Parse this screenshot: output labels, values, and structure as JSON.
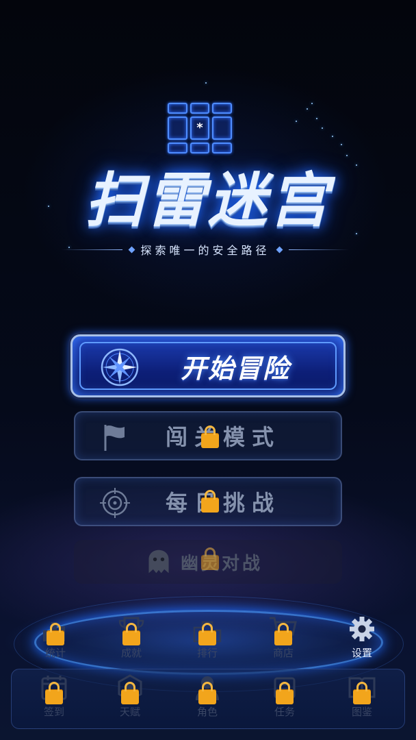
{
  "app": {
    "title": "扫雷迷宫",
    "subtitle": "探索唯一的安全路径",
    "logo_center_symbol": "*"
  },
  "menu": {
    "start": {
      "label": "开始冒险",
      "icon": "compass-icon",
      "locked": false
    },
    "level_mode": {
      "label": "闯关模式",
      "icon": "flag-icon",
      "locked": true
    },
    "daily_challenge": {
      "label": "每日挑战",
      "icon": "target-icon",
      "locked": true
    },
    "ghost_battle": {
      "label": "幽灵对战",
      "icon": "ghost-icon",
      "locked": true
    }
  },
  "nav_top": [
    {
      "label": "统计",
      "icon": "bar-chart-icon",
      "locked": true
    },
    {
      "label": "成就",
      "icon": "trophy-icon",
      "locked": true
    },
    {
      "label": "排行",
      "icon": "podium-icon",
      "locked": true
    },
    {
      "label": "商店",
      "icon": "cart-icon",
      "locked": true
    },
    {
      "label": "设置",
      "icon": "gear-icon",
      "locked": false
    }
  ],
  "nav_bottom": [
    {
      "label": "签到",
      "icon": "calendar-icon",
      "locked": true
    },
    {
      "label": "天赋",
      "icon": "talent-icon",
      "locked": true
    },
    {
      "label": "角色",
      "icon": "character-icon",
      "locked": true
    },
    {
      "label": "任务",
      "icon": "scroll-icon",
      "locked": true
    },
    {
      "label": "图鉴",
      "icon": "book-icon",
      "locked": true
    }
  ],
  "colors": {
    "accent": "#2f6dff",
    "lock": "#f2a51c",
    "background": "#03050c"
  }
}
